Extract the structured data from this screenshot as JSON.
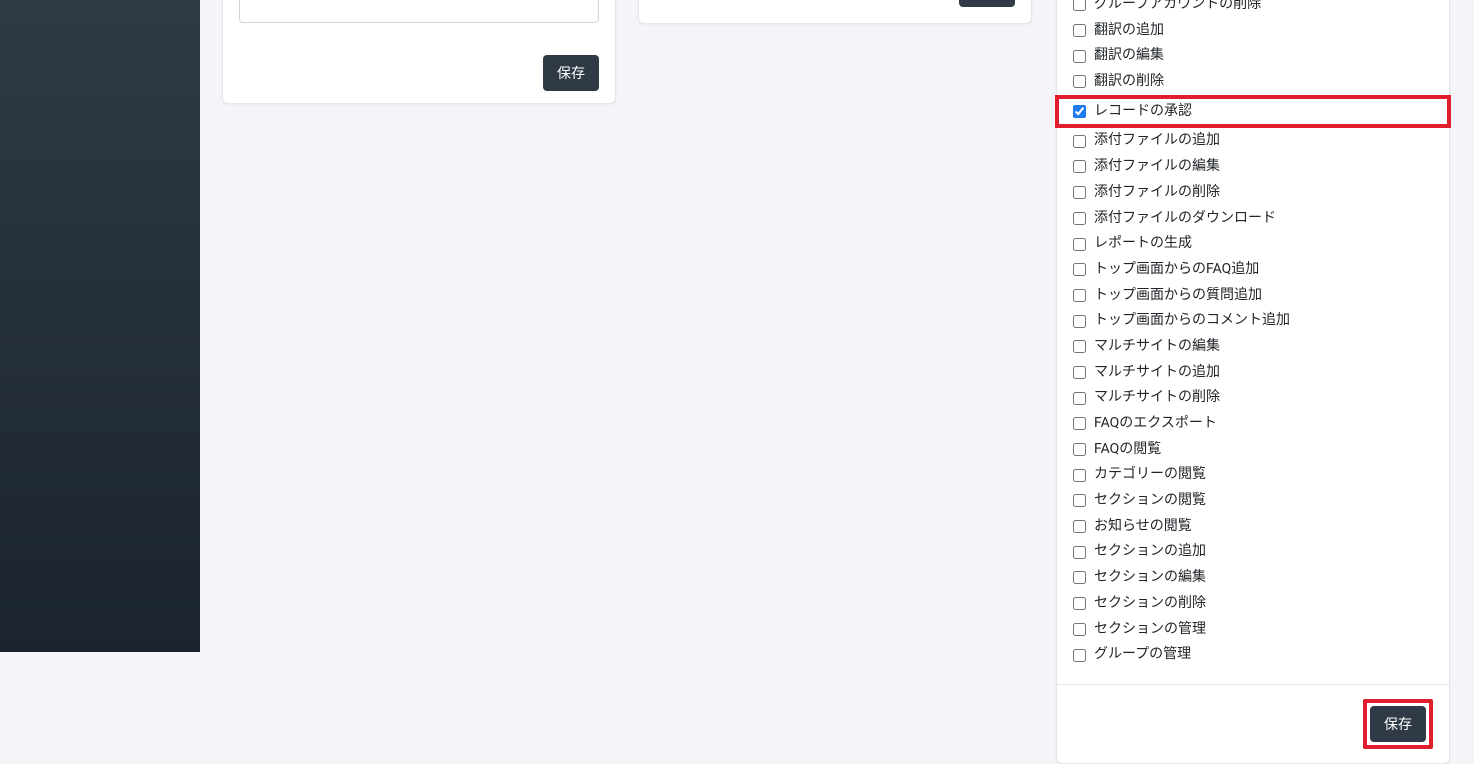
{
  "buttons": {
    "save": "保存"
  },
  "permissions": [
    {
      "label": "グループアカウントの削除",
      "checked": false
    },
    {
      "label": "翻訳の追加",
      "checked": false
    },
    {
      "label": "翻訳の編集",
      "checked": false
    },
    {
      "label": "翻訳の削除",
      "checked": false
    },
    {
      "label": "レコードの承認",
      "checked": true,
      "highlighted": true
    },
    {
      "label": "添付ファイルの追加",
      "checked": false
    },
    {
      "label": "添付ファイルの編集",
      "checked": false
    },
    {
      "label": "添付ファイルの削除",
      "checked": false
    },
    {
      "label": "添付ファイルのダウンロード",
      "checked": false
    },
    {
      "label": "レポートの生成",
      "checked": false
    },
    {
      "label": "トップ画面からのFAQ追加",
      "checked": false
    },
    {
      "label": "トップ画面からの質問追加",
      "checked": false
    },
    {
      "label": "トップ画面からのコメント追加",
      "checked": false
    },
    {
      "label": "マルチサイトの編集",
      "checked": false
    },
    {
      "label": "マルチサイトの追加",
      "checked": false
    },
    {
      "label": "マルチサイトの削除",
      "checked": false
    },
    {
      "label": "FAQのエクスポート",
      "checked": false
    },
    {
      "label": "FAQの閲覧",
      "checked": false
    },
    {
      "label": "カテゴリーの閲覧",
      "checked": false
    },
    {
      "label": "セクションの閲覧",
      "checked": false
    },
    {
      "label": "お知らせの閲覧",
      "checked": false
    },
    {
      "label": "セクションの追加",
      "checked": false
    },
    {
      "label": "セクションの編集",
      "checked": false
    },
    {
      "label": "セクションの削除",
      "checked": false
    },
    {
      "label": "セクションの管理",
      "checked": false
    },
    {
      "label": "グループの管理",
      "checked": false
    }
  ]
}
